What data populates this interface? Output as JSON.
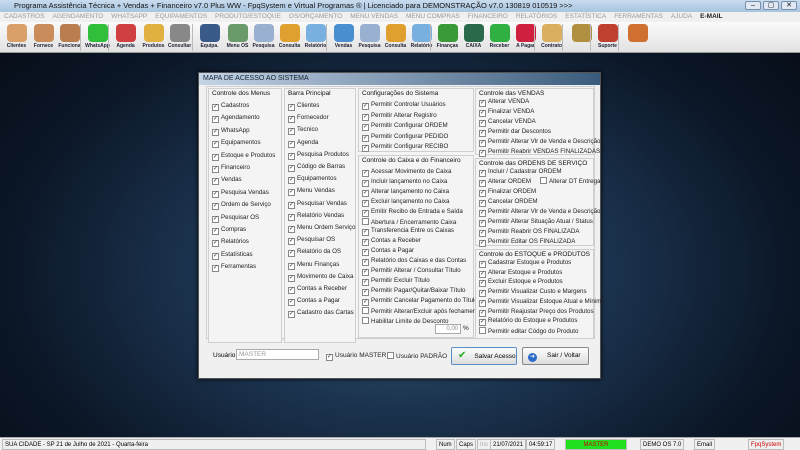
{
  "window": {
    "title": "Programa Assistência Técnica + Vendas + Financeiro v7.0 Plus WW - FpqSystem e Virtual Programas ® | Licenciado para  DEMONSTRAÇÃO v7.0 130819 010519 >>>",
    "min": "–",
    "max": "▢",
    "close": "✕"
  },
  "menu": [
    "CADASTROS",
    "AGENDAMENTO",
    "WHATSAPP",
    "EQUIPAMENTOS",
    "PRODUTO/ESTOQUE",
    "OS/ORÇAMENTO",
    "MENU VENDAS",
    "MENU COMPRAS",
    "FINANCEIRO",
    "RELATÓRIOS",
    "ESTATÍSTICA",
    "FERRAMENTAS",
    "AJUDA",
    "E-MAIL"
  ],
  "toolbar": [
    {
      "label": "Clientes",
      "color": "#d9a06a"
    },
    {
      "label": "Fornece",
      "color": "#c98c5a"
    },
    {
      "label": "Funciona",
      "color": "#b97d50"
    },
    {
      "label": "WhatsApp",
      "color": "#2fbf3a"
    },
    {
      "label": "Agenda",
      "color": "#d04040"
    },
    {
      "label": "Produtos",
      "color": "#e0b040"
    },
    {
      "label": "Consultar",
      "color": "#888888"
    },
    {
      "label": "Equipa.",
      "color": "#3a5a8a"
    },
    {
      "label": "Menu OS",
      "color": "#6a9a6a"
    },
    {
      "label": "Pesquisa",
      "color": "#9ab0d0"
    },
    {
      "label": "Consulta",
      "color": "#e0a030"
    },
    {
      "label": "Relatório",
      "color": "#7ab0e0"
    },
    {
      "label": "Vendas",
      "color": "#4a90d0"
    },
    {
      "label": "Pesquisa",
      "color": "#9ab0d0"
    },
    {
      "label": "Consulta",
      "color": "#e0a030"
    },
    {
      "label": "Relatório",
      "color": "#7ab0e0"
    },
    {
      "label": "Finanças",
      "color": "#3a9a3a"
    },
    {
      "label": "CAIXA",
      "color": "#2a6a4a"
    },
    {
      "label": "Receber",
      "color": "#2fb040"
    },
    {
      "label": "A Pagar",
      "color": "#d02040"
    },
    {
      "label": "Contrato",
      "color": "#d8b060"
    },
    {
      "label": "",
      "color": "#b09040"
    },
    {
      "label": "Suporte",
      "color": "#c04030"
    },
    {
      "label": "",
      "color": "#d07030"
    }
  ],
  "dialog": {
    "title": "MAPA DE ACESSO AO SISTEMA",
    "menus": {
      "title": "Controle dos Menus",
      "items": [
        [
          "Cadastros",
          true
        ],
        [
          "Agendamento",
          true
        ],
        [
          "WhatsApp",
          true
        ],
        [
          "Equipamentos",
          true
        ],
        [
          "Estoque e Produtos",
          true
        ],
        [
          "Financeiro",
          true
        ],
        [
          "Vendas",
          true
        ],
        [
          "Pesquisa Vendas",
          true
        ],
        [
          "Ordem de Serviço",
          true
        ],
        [
          "Pesquisar OS",
          true
        ],
        [
          "Compras",
          true
        ],
        [
          "Relatórios",
          true
        ],
        [
          "Estatísticas",
          true
        ],
        [
          "Ferramentas",
          true
        ]
      ]
    },
    "barra": {
      "title": "Barra Principal",
      "items": [
        [
          "Clientes",
          true
        ],
        [
          "Fornecedor",
          true
        ],
        [
          "Tecnico",
          true
        ],
        [
          "Agenda",
          true
        ],
        [
          "Pesquisa Produtos",
          true
        ],
        [
          "Código de Barras",
          true
        ],
        [
          "Equipamentos",
          true
        ],
        [
          "Menu Vendas",
          true
        ],
        [
          "Pesquisar Vendas",
          true
        ],
        [
          "Relatório Vendas",
          true
        ],
        [
          "Menu Ordem Serviço",
          true
        ],
        [
          "Pesquisar OS",
          true
        ],
        [
          "Relatório da OS",
          true
        ],
        [
          "Menu Finanças",
          true
        ],
        [
          "Movimento de Caixa",
          true
        ],
        [
          "Contas a Receber",
          true
        ],
        [
          "Contas a Pagar",
          true
        ],
        [
          "Cadastro das Cartas",
          true
        ]
      ]
    },
    "config": {
      "title": "Configurações do Sistema",
      "items": [
        [
          "Permitir Controlar Usuários",
          true
        ],
        [
          "Permitir Alterar Registro",
          true
        ],
        [
          "Permitir Configurar ORDEM",
          true
        ],
        [
          "Permitir Configurar PEDIDO",
          true
        ],
        [
          "Permitir Configurar RECIBO",
          true
        ]
      ]
    },
    "caixa": {
      "title": "Controle do Caixa e do Financeiro",
      "items": [
        [
          "Acessar Movimento de Caixa",
          true
        ],
        [
          "Incluir lançamento no Caixa",
          true
        ],
        [
          "Alterar lançamento no Caixa",
          true
        ],
        [
          "Excluir lançamento no Caixa",
          true
        ],
        [
          "Emitir Recibo de Entrada e Saída",
          true
        ],
        [
          "Abertura / Encerramento Caixa",
          false
        ],
        [
          "Transferencia Entre os Caixas",
          true
        ],
        [
          "Contas a Receber",
          true
        ],
        [
          "Contas a Pagar",
          true
        ],
        [
          "Relatório dos Caixas e das Contas",
          true
        ],
        [
          "Permitir Alterar / Consultar Título",
          true
        ],
        [
          "Permitir Excluir Título",
          true
        ],
        [
          "Permitir Pagar/Quitar/Baixar Título",
          true
        ],
        [
          "Permitir Cancelar Pagamento do Título",
          true
        ],
        [
          "Permitir Alterar/Excluir após fechamento",
          false
        ],
        [
          "Habilitar Limite de Desconto",
          false
        ]
      ],
      "discount": "0,00",
      "pct": "%"
    },
    "vendas": {
      "title": "Controle das VENDAS",
      "items": [
        [
          "Alterar VENDA",
          true
        ],
        [
          "Finalizar VENDA",
          true
        ],
        [
          "Cancelar VENDA",
          true
        ],
        [
          "Permitir dar Descontos",
          true
        ],
        [
          "Permitir Alterar Vlr de Venda e Descrição",
          true
        ],
        [
          "Permitir Reabrir VENDAS FINALIZADAS",
          true
        ]
      ]
    },
    "os": {
      "title": "Controle das ORDENS DE SERVIÇO",
      "items": [
        [
          "Incluir / Cadastrar ORDEM",
          true
        ],
        [
          "Alterar ORDEM",
          true
        ],
        [
          "Finalizar ORDEM",
          true
        ],
        [
          "Cancelar ORDEM",
          true
        ],
        [
          "Permitir Alterar Vlr de Venda e Descrição",
          true
        ],
        [
          "Permitir Alterar Situação Atual / Status",
          true
        ],
        [
          "Permitir Reabrir OS FINALIZADA",
          true
        ],
        [
          "Permitir Editar OS FINALIZADA",
          true
        ]
      ],
      "extra": [
        "Alterar DT Entrega",
        false
      ]
    },
    "estoque": {
      "title": "Controle do ESTOQUE e PRODUTOS",
      "items": [
        [
          "Cadastrar Estoque e Produtos",
          true
        ],
        [
          "Alterar Estoque e Produtos",
          true
        ],
        [
          "Excluir Estoque e Produtos",
          true
        ],
        [
          "Permitir Visualizar Custo e Margens",
          true
        ],
        [
          "Permitir Visualizar Estoque Atual e Mínimo",
          true
        ],
        [
          "Permitir Reajustar Preço dos Produtos",
          true
        ],
        [
          "Relatório do Estoque e Produtos",
          true
        ],
        [
          "Permitir editar Códgo do Produto",
          false
        ]
      ]
    },
    "user_label": "Usuário:",
    "user_value": "MASTER",
    "master": [
      "Usuário MASTER",
      true
    ],
    "padrao": [
      "Usuário PADRÃO",
      false
    ],
    "save": "Salvar Acesso",
    "exit": "Sair / Voltar"
  },
  "status": {
    "city": "SUA CIDADE - SP 21 de Julho de 2021 - Quarta-feira",
    "num": "Num",
    "caps": "Caps",
    "ins": "Ins",
    "date": "21/07/2021",
    "time": "04:59:17",
    "user": "MASTER",
    "demo": "DEMO OS 7.0",
    "email": "Email",
    "brand": "FpqSystem"
  }
}
